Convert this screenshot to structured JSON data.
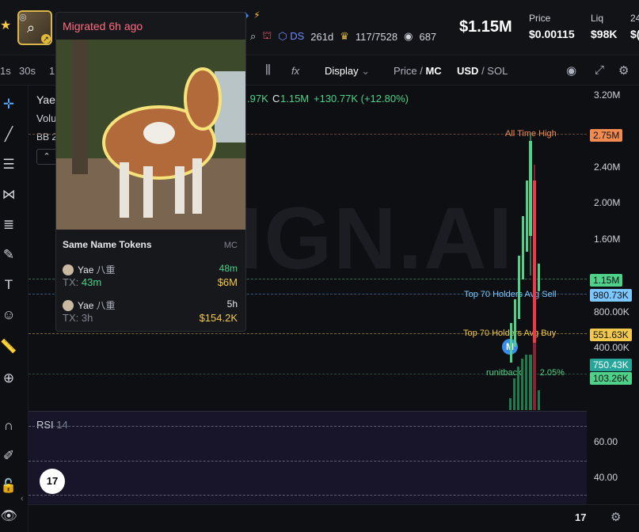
{
  "header": {
    "migrated_text": "Migrated 6h ago",
    "ds_label": "DS",
    "age": "261d",
    "holders_ratio": "117/7528",
    "views": "687",
    "market_cap": "$1.15M",
    "price_label": "Price",
    "price_value": "$0.00115",
    "liq_label": "Liq",
    "liq_value": "$98K",
    "extra_label": "24",
    "extra_value": "$("
  },
  "toolbar": {
    "interval_1s": "1s",
    "interval_30s": "30s",
    "interval_partial": "1",
    "display": "Display",
    "price_mc_a": "Price /",
    "price_mc_b": "MC",
    "usd": "USD",
    "sol": "/ SOL"
  },
  "chart": {
    "symbol": "Yae",
    "volume_label": "Volu",
    "bb_label": "BB 2",
    "ohlc_partial": ".97K",
    "close_label": "C",
    "close_value": "1.15M",
    "change": "+130.77K (+12.80%)",
    "watermark": "IGN.AI",
    "all_time_high_label": "All Time High",
    "top70_sell_label": "Top 70 Holders Avg Sell",
    "top70_buy_label": "Top 70 Holders Avg Buy",
    "runitback_label": "runitback",
    "runitback_pct": "2.05%",
    "marker_letter": "M",
    "colors": {
      "up": "#4ed28a",
      "down": "#f23645",
      "ath": "#f28b50",
      "sell": "#7cc7ff",
      "buy": "#f2c94c"
    }
  },
  "price_axis": {
    "ticks": [
      "3.20M",
      "2.40M",
      "2.00M",
      "1.60M",
      "800.00K",
      "400.00K"
    ],
    "badge_ath": "2.75M",
    "badge_current": "1.15M",
    "badge_sell": "980.73K",
    "badge_buy": "551.63K",
    "badge_vol_a": "750.43K",
    "badge_vol_b": "103.26K"
  },
  "rsi": {
    "label": "RSI",
    "period": "14",
    "ticks": [
      "60.00",
      "40.00"
    ]
  },
  "bottom": {
    "date_tick": "17"
  },
  "popup": {
    "section_title": "Same Name Tokens",
    "mc_label": "MC",
    "tokens": [
      {
        "name": "Yae",
        "cjk": "八重",
        "age": "48m",
        "tx_label": "TX:",
        "tx": "43m",
        "mc": "$6M"
      },
      {
        "name": "Yae",
        "cjk": "八重",
        "age": "5h",
        "tx_label": "TX:",
        "tx": "3h",
        "mc": "$154.2K"
      }
    ]
  },
  "icons": {
    "star": "★",
    "search": "⌕",
    "lightning": "⚡",
    "fx": "fx",
    "camera": "◉",
    "expand": "⤢",
    "gear": "⚙"
  }
}
